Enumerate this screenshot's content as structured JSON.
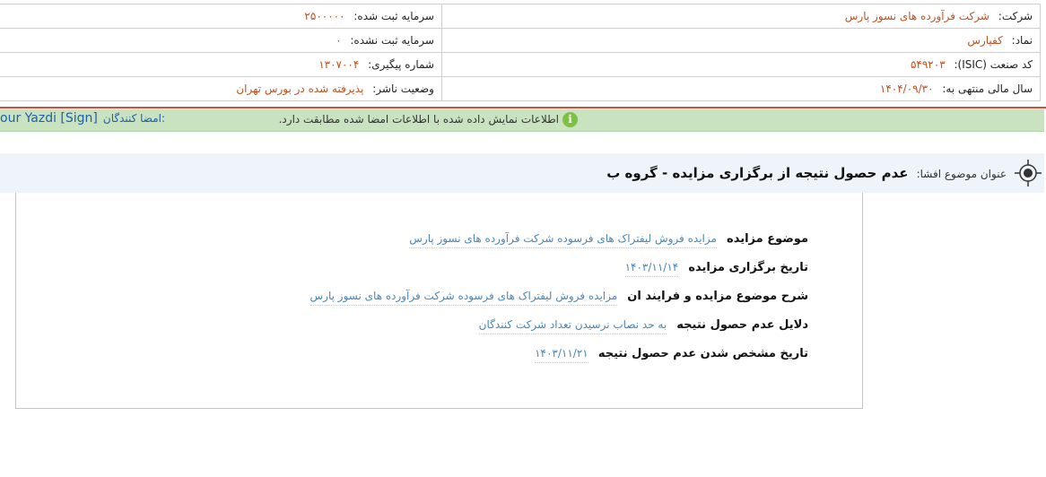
{
  "company": {
    "company_label": "شرکت:",
    "company_value": "شرکت فرآورده های نسوز پارس",
    "registered_capital_label": "سرمایه ثبت شده:",
    "registered_capital_value": "۲۵۰۰۰۰۰",
    "symbol_label": "نماد:",
    "symbol_value": "کفپارس",
    "unregistered_capital_label": "سرمایه ثبت نشده:",
    "unregistered_capital_value": "۰",
    "isic_label": "کد صنعت (ISIC):",
    "isic_value": "۵۴۹۲۰۳",
    "tracking_label": "شماره پیگیری:",
    "tracking_value": "۱۳۰۷۰۰۴",
    "fiscal_year_label": "سال مالی منتهی به:",
    "fiscal_year_value": "۱۴۰۴/۰۹/۳۰",
    "publisher_status_label": "وضعیت ناشر:",
    "publisher_status_value": "پذیرفته شده در بورس تهران"
  },
  "signature_bar": {
    "signers_label": "امضا کنندگان:",
    "signers_value": "our Yazdi [Sign]",
    "notice_text": "اطلاعات نمایش داده شده با اطلاعات امضا شده مطابقت دارد.",
    "info_icon_glyph": "i"
  },
  "disclosure": {
    "title_label": "عنوان موضوع افشا:",
    "title_value": "عدم حصول نتیجه از برگزاری مزایده - گروه ب"
  },
  "details": [
    {
      "label": "موضوع مزایده",
      "value": "مزایده فروش لیفتراک های فرسوده شرکت فرآورده های نسوز پارس"
    },
    {
      "label": "تاریخ برگزاری مزایده",
      "value": "۱۴۰۳/۱۱/۱۴"
    },
    {
      "label": "شرح موضوع مزایده و فرایند ان",
      "value": "مزایده فروش لیفتراک های فرسوده شرکت فرآورده های نسوز پارس"
    },
    {
      "label": "دلایل عدم حصول نتیجه",
      "value": "به حد نصاب نرسیدن تعداد شرکت کنندگان"
    },
    {
      "label": "تاریخ مشخص شدن عدم حصول نتیجه",
      "value": "۱۴۰۳/۱۱/۲۱"
    }
  ],
  "colors": {
    "value_orange": "#c0501f",
    "accent_red": "#e2463c",
    "sign_bar_green": "#c9e3c1",
    "info_icon_green": "#7cc242",
    "link_blue": "#1f5fa8",
    "detail_value_blue": "#4a86b8",
    "title_bar_bg": "#eef4fa"
  }
}
